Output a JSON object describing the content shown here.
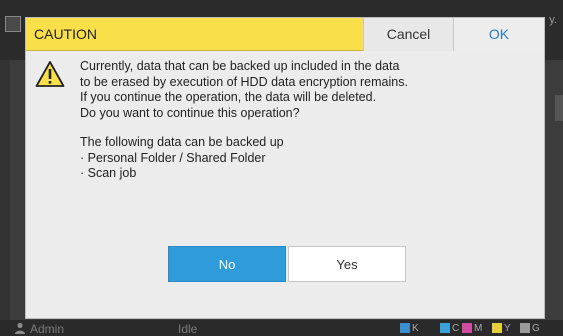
{
  "background": {
    "status_tail": "y.",
    "user_label": "Admin",
    "status_label": "Idle",
    "toner": [
      {
        "label": "K",
        "color": "#3a8fd0"
      },
      {
        "label": "C",
        "color": "#3aa0d8"
      },
      {
        "label": "M",
        "color": "#d04ca0"
      },
      {
        "label": "Y",
        "color": "#e6cf3a"
      },
      {
        "label": "G",
        "color": "#9a9a9a"
      }
    ]
  },
  "dialog": {
    "title": "CAUTION",
    "cancel_label": "Cancel",
    "ok_label": "OK",
    "message_lines": [
      "Currently, data that can be backed up included in the data",
      "to be erased by execution of HDD data encryption remains.",
      "If you continue the operation, the data will be deleted.",
      "Do you want to continue this operation?"
    ],
    "backup_heading": "The following data can be backed up",
    "backup_items": [
      "· Personal Folder / Shared Folder",
      "· Scan job"
    ],
    "no_label": "No",
    "yes_label": "Yes",
    "colors": {
      "title_bar": "#f9e04a",
      "accent": "#2f9bdb"
    }
  }
}
